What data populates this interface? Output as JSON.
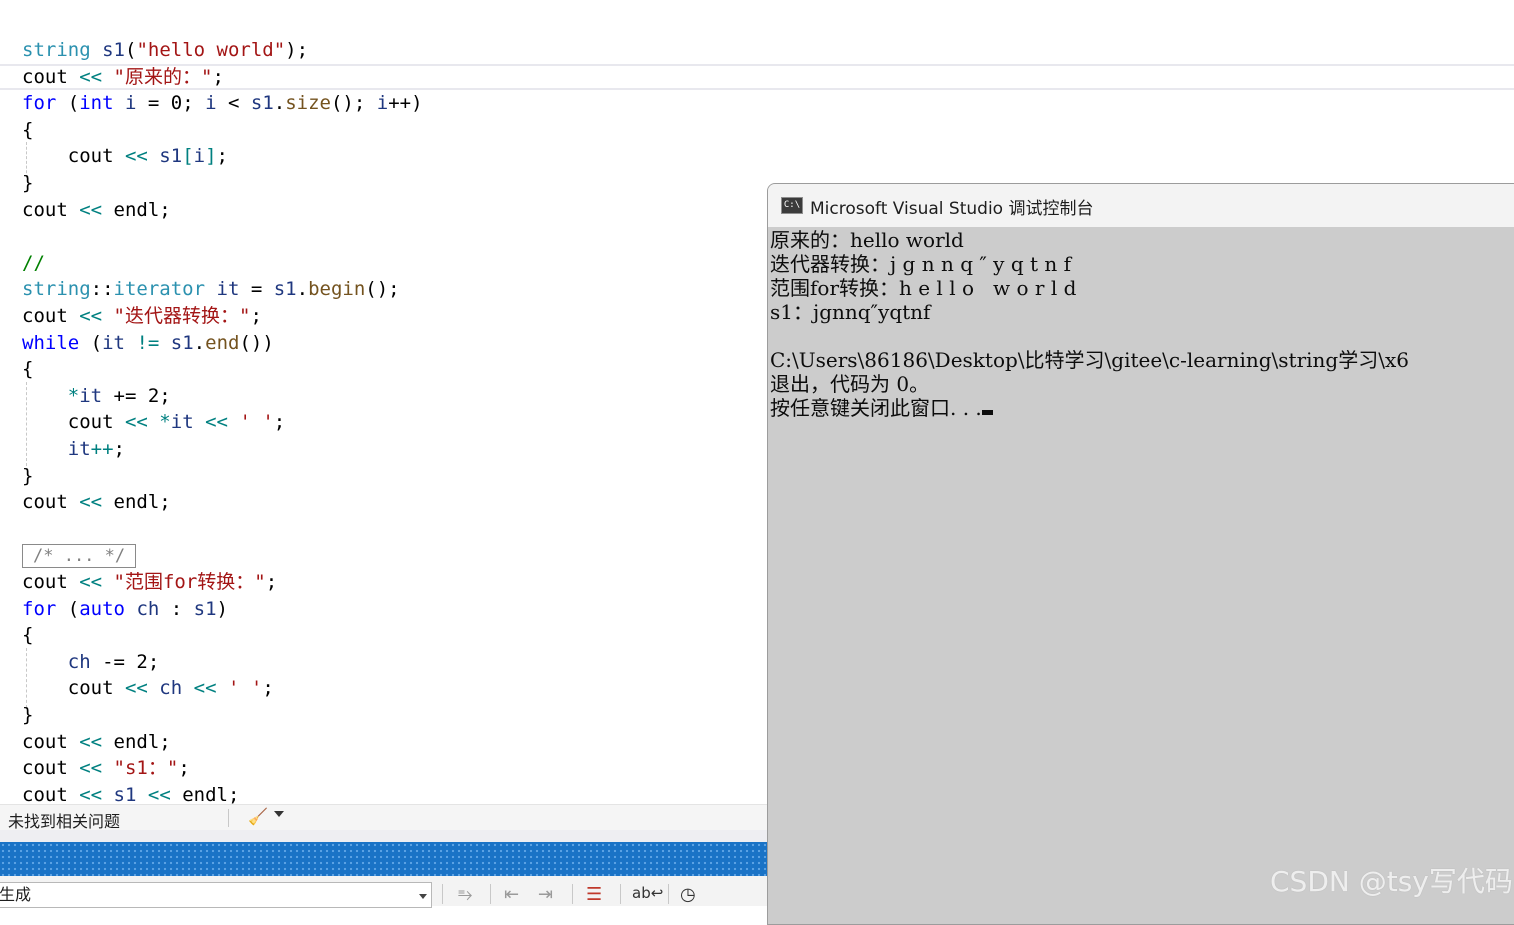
{
  "editor": {
    "code_lines": [
      {
        "segments": [
          {
            "cls": "t",
            "text": "string"
          },
          {
            "cls": "",
            "text": " "
          },
          {
            "cls": "v",
            "text": "s1"
          },
          {
            "cls": "",
            "text": "("
          },
          {
            "cls": "s",
            "text": "\"hello world\""
          },
          {
            "cls": "",
            "text": ");"
          }
        ]
      },
      {
        "segments": [
          {
            "cls": "",
            "text": "cout "
          },
          {
            "cls": "o",
            "text": "<<"
          },
          {
            "cls": "",
            "text": " "
          },
          {
            "cls": "s",
            "text": "\"原来的：\""
          },
          {
            "cls": "",
            "text": ";"
          }
        ]
      },
      {
        "segments": [
          {
            "cls": "k",
            "text": "for"
          },
          {
            "cls": "",
            "text": " ("
          },
          {
            "cls": "k",
            "text": "int"
          },
          {
            "cls": "",
            "text": " "
          },
          {
            "cls": "v",
            "text": "i"
          },
          {
            "cls": "",
            "text": " = 0; "
          },
          {
            "cls": "v",
            "text": "i"
          },
          {
            "cls": "",
            "text": " < "
          },
          {
            "cls": "v",
            "text": "s1"
          },
          {
            "cls": "",
            "text": "."
          },
          {
            "cls": "f",
            "text": "size"
          },
          {
            "cls": "",
            "text": "(); "
          },
          {
            "cls": "v",
            "text": "i"
          },
          {
            "cls": "",
            "text": "++)"
          }
        ]
      },
      {
        "segments": [
          {
            "cls": "",
            "text": "{"
          }
        ]
      },
      {
        "segments": [
          {
            "cls": "",
            "text": "    cout "
          },
          {
            "cls": "o",
            "text": "<<"
          },
          {
            "cls": "",
            "text": " "
          },
          {
            "cls": "v",
            "text": "s1"
          },
          {
            "cls": "o",
            "text": "["
          },
          {
            "cls": "v",
            "text": "i"
          },
          {
            "cls": "o",
            "text": "]"
          },
          {
            "cls": "",
            "text": ";"
          }
        ]
      },
      {
        "segments": [
          {
            "cls": "",
            "text": "}"
          }
        ]
      },
      {
        "segments": [
          {
            "cls": "",
            "text": "cout "
          },
          {
            "cls": "o",
            "text": "<<"
          },
          {
            "cls": "",
            "text": " endl;"
          }
        ]
      },
      {
        "segments": [
          {
            "cls": "",
            "text": ""
          }
        ]
      },
      {
        "segments": [
          {
            "cls": "c",
            "text": "//"
          }
        ]
      },
      {
        "segments": [
          {
            "cls": "t",
            "text": "string"
          },
          {
            "cls": "",
            "text": "::"
          },
          {
            "cls": "t",
            "text": "iterator"
          },
          {
            "cls": "",
            "text": " "
          },
          {
            "cls": "v",
            "text": "it"
          },
          {
            "cls": "",
            "text": " = "
          },
          {
            "cls": "v",
            "text": "s1"
          },
          {
            "cls": "",
            "text": "."
          },
          {
            "cls": "f",
            "text": "begin"
          },
          {
            "cls": "",
            "text": "();"
          }
        ]
      },
      {
        "segments": [
          {
            "cls": "",
            "text": "cout "
          },
          {
            "cls": "o",
            "text": "<<"
          },
          {
            "cls": "",
            "text": " "
          },
          {
            "cls": "s",
            "text": "\"迭代器转换：\""
          },
          {
            "cls": "",
            "text": ";"
          }
        ]
      },
      {
        "segments": [
          {
            "cls": "k",
            "text": "while"
          },
          {
            "cls": "",
            "text": " ("
          },
          {
            "cls": "v",
            "text": "it"
          },
          {
            "cls": "",
            "text": " "
          },
          {
            "cls": "o",
            "text": "!="
          },
          {
            "cls": "",
            "text": " "
          },
          {
            "cls": "v",
            "text": "s1"
          },
          {
            "cls": "",
            "text": "."
          },
          {
            "cls": "f",
            "text": "end"
          },
          {
            "cls": "",
            "text": "())"
          }
        ]
      },
      {
        "segments": [
          {
            "cls": "",
            "text": "{"
          }
        ]
      },
      {
        "segments": [
          {
            "cls": "",
            "text": "    "
          },
          {
            "cls": "o",
            "text": "*"
          },
          {
            "cls": "v",
            "text": "it"
          },
          {
            "cls": "",
            "text": " += 2;"
          }
        ]
      },
      {
        "segments": [
          {
            "cls": "",
            "text": "    cout "
          },
          {
            "cls": "o",
            "text": "<<"
          },
          {
            "cls": "",
            "text": " "
          },
          {
            "cls": "o",
            "text": "*"
          },
          {
            "cls": "v",
            "text": "it"
          },
          {
            "cls": "",
            "text": " "
          },
          {
            "cls": "o",
            "text": "<<"
          },
          {
            "cls": "",
            "text": " "
          },
          {
            "cls": "s",
            "text": "' '"
          },
          {
            "cls": "",
            "text": ";"
          }
        ]
      },
      {
        "segments": [
          {
            "cls": "",
            "text": "    "
          },
          {
            "cls": "v",
            "text": "it"
          },
          {
            "cls": "o",
            "text": "++"
          },
          {
            "cls": "",
            "text": ";"
          }
        ]
      },
      {
        "segments": [
          {
            "cls": "",
            "text": "}"
          }
        ]
      },
      {
        "segments": [
          {
            "cls": "",
            "text": "cout "
          },
          {
            "cls": "o",
            "text": "<<"
          },
          {
            "cls": "",
            "text": " endl;"
          }
        ]
      },
      {
        "segments": [
          {
            "cls": "",
            "text": ""
          }
        ]
      },
      {
        "collapsed": "/* ... */"
      },
      {
        "segments": [
          {
            "cls": "",
            "text": "cout "
          },
          {
            "cls": "o",
            "text": "<<"
          },
          {
            "cls": "",
            "text": " "
          },
          {
            "cls": "s",
            "text": "\"范围for转换：\""
          },
          {
            "cls": "",
            "text": ";"
          }
        ]
      },
      {
        "segments": [
          {
            "cls": "k",
            "text": "for"
          },
          {
            "cls": "",
            "text": " ("
          },
          {
            "cls": "k",
            "text": "auto"
          },
          {
            "cls": "",
            "text": " "
          },
          {
            "cls": "v",
            "text": "ch"
          },
          {
            "cls": "",
            "text": " : "
          },
          {
            "cls": "v",
            "text": "s1"
          },
          {
            "cls": "",
            "text": ")"
          }
        ]
      },
      {
        "segments": [
          {
            "cls": "",
            "text": "{"
          }
        ]
      },
      {
        "segments": [
          {
            "cls": "",
            "text": "    "
          },
          {
            "cls": "v",
            "text": "ch"
          },
          {
            "cls": "",
            "text": " -= 2;"
          }
        ]
      },
      {
        "segments": [
          {
            "cls": "",
            "text": "    cout "
          },
          {
            "cls": "o",
            "text": "<<"
          },
          {
            "cls": "",
            "text": " "
          },
          {
            "cls": "v",
            "text": "ch"
          },
          {
            "cls": "",
            "text": " "
          },
          {
            "cls": "o",
            "text": "<<"
          },
          {
            "cls": "",
            "text": " "
          },
          {
            "cls": "s",
            "text": "' '"
          },
          {
            "cls": "",
            "text": ";"
          }
        ]
      },
      {
        "segments": [
          {
            "cls": "",
            "text": "}"
          }
        ]
      },
      {
        "segments": [
          {
            "cls": "",
            "text": "cout "
          },
          {
            "cls": "o",
            "text": "<<"
          },
          {
            "cls": "",
            "text": " endl;"
          }
        ]
      },
      {
        "segments": [
          {
            "cls": "",
            "text": "cout "
          },
          {
            "cls": "o",
            "text": "<<"
          },
          {
            "cls": "",
            "text": " "
          },
          {
            "cls": "s",
            "text": "\"s1：\""
          },
          {
            "cls": "",
            "text": ";"
          }
        ]
      },
      {
        "segments": [
          {
            "cls": "",
            "text": "cout "
          },
          {
            "cls": "o",
            "text": "<<"
          },
          {
            "cls": "",
            "text": " "
          },
          {
            "cls": "v",
            "text": "s1"
          },
          {
            "cls": "",
            "text": " "
          },
          {
            "cls": "o",
            "text": "<<"
          },
          {
            "cls": "",
            "text": " endl;"
          }
        ]
      }
    ]
  },
  "error_bar": {
    "status_text": "未找到相关问题",
    "icon": "broom-icon"
  },
  "output_bar": {
    "source_value": "生成",
    "icons": [
      "find-prev-icon",
      "align-left-icon",
      "align-right-icon",
      "clear-all-icon",
      "word-wrap-icon",
      "clock-icon"
    ]
  },
  "console": {
    "title": "Microsoft Visual Studio 调试控制台",
    "icon_label": "C:\\",
    "lines": [
      "原来的：hello world",
      "迭代器转换：j g n n q ″ y q t n f",
      "范围for转换：h e l l o   w o r l d",
      "s1：jgnnq″yqtnf",
      "",
      "C:\\Users\\86186\\Desktop\\比特学习\\gitee\\c-learning\\string学习\\x6",
      "退出，代码为 0。",
      "按任意键关闭此窗口. . ."
    ]
  },
  "watermark": "CSDN @tsy写代码"
}
